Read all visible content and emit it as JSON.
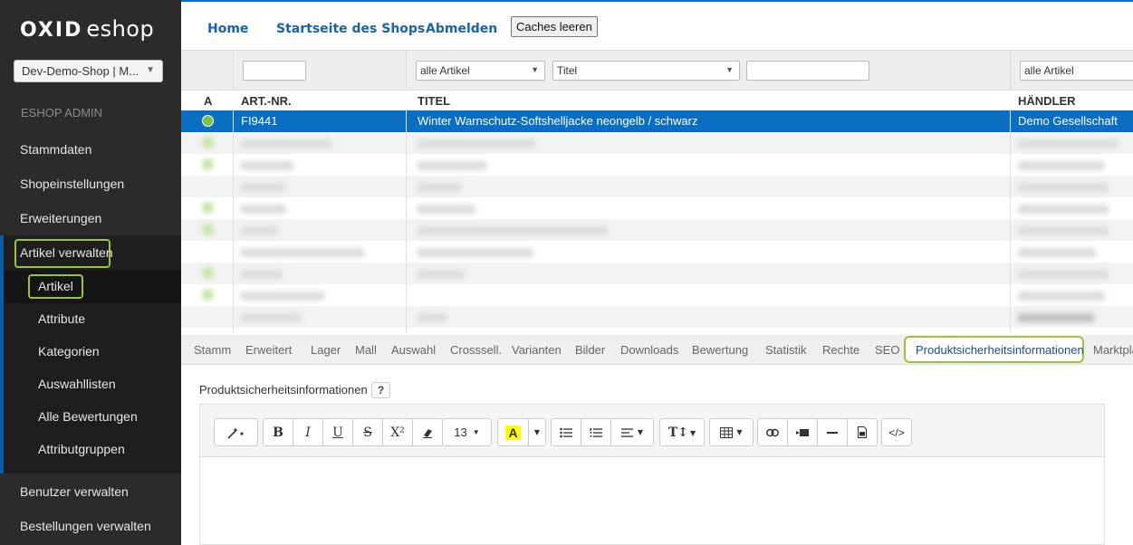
{
  "brand": {
    "logo_part1": "OXID",
    "logo_part2": "eshop"
  },
  "shop_select": {
    "value": "Dev-Demo-Shop | M..."
  },
  "sidebar": {
    "section_label": "ESHOP ADMIN",
    "items": [
      {
        "label": "Stammdaten"
      },
      {
        "label": "Shopeinstellungen"
      },
      {
        "label": "Erweiterungen"
      },
      {
        "label": "Artikel verwalten"
      },
      {
        "label": "Benutzer verwalten"
      },
      {
        "label": "Bestellungen verwalten"
      }
    ],
    "subitems": [
      {
        "label": "Artikel"
      },
      {
        "label": "Attribute"
      },
      {
        "label": "Kategorien"
      },
      {
        "label": "Auswahllisten"
      },
      {
        "label": "Alle Bewertungen"
      },
      {
        "label": "Attributgruppen"
      }
    ]
  },
  "topnav": {
    "home": "Home",
    "shop_start": "Startseite des Shops",
    "logout": "Abmelden",
    "clear_cache": "Caches leeren"
  },
  "filters": {
    "type_select": "alle Artikel",
    "title_select": "Titel",
    "vendor_select": "alle Artikel"
  },
  "table": {
    "headers": {
      "active": "A",
      "artnum": "ART.-NR.",
      "title": "TITEL",
      "vendor": "HÄNDLER"
    },
    "selected_row": {
      "artnum": "FI9441",
      "title": "Winter Warnschutz-Softshelljacke neongelb / schwarz",
      "vendor": "Demo Gesellschaft"
    }
  },
  "tabs": [
    {
      "label": "Stamm"
    },
    {
      "label": "Erweitert"
    },
    {
      "label": "Lager"
    },
    {
      "label": "Mall"
    },
    {
      "label": "Auswahl"
    },
    {
      "label": "Crosssell."
    },
    {
      "label": "Varianten"
    },
    {
      "label": "Bilder"
    },
    {
      "label": "Downloads"
    },
    {
      "label": "Bewertung"
    },
    {
      "label": "Statistik"
    },
    {
      "label": "Rechte"
    },
    {
      "label": "SEO"
    },
    {
      "label": "Produktsicherheitsinformationen"
    },
    {
      "label": "Marktpla"
    }
  ],
  "content": {
    "field_label": "Produktsicherheitsinformationen",
    "help_label": "?"
  },
  "toolbar": {
    "font_size": "13",
    "bold": "B",
    "italic": "I",
    "underline": "U",
    "strike": "S",
    "superscript": "X²",
    "highlight": "A",
    "code": "</>"
  },
  "colors": {
    "sidebar_bg": "#2b2b2b",
    "accent_blue": "#0a6fc2",
    "highlight_green": "#9ac43b",
    "active_check": "#7dc243"
  }
}
